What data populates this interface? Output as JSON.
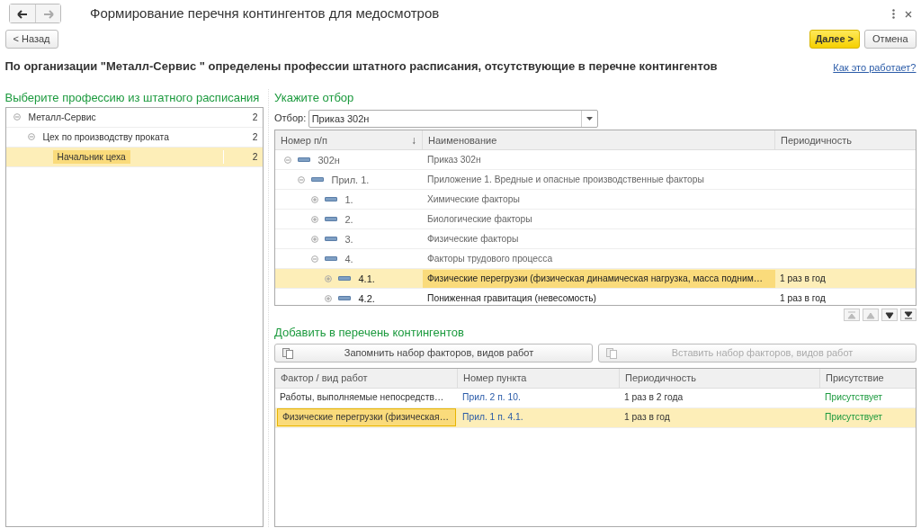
{
  "window": {
    "title": "Формирование перечня контингентов для медосмотров"
  },
  "toolbar": {
    "back": "< Назад",
    "next": "Далее >",
    "cancel": "Отмена"
  },
  "heading": "По организации \"Металл-Сервис \" определены профессии штатного расписания, отсутствующие в перечне контингентов",
  "help_link": "Как это работает?",
  "professions": {
    "title": "Выберите профессию из штатного расписания",
    "items": [
      {
        "label": "Металл-Сервис",
        "count": "2",
        "expanded": true,
        "selected": false,
        "children": [
          {
            "label": "Цех по производству проката",
            "count": "2",
            "expanded": true,
            "selected": false,
            "children": [
              {
                "label": "Начальник цеха",
                "count": "2",
                "selected": true
              }
            ]
          }
        ]
      }
    ]
  },
  "filter": {
    "title": "Укажите отбор",
    "label": "Отбор:",
    "value": "Приказ 302н"
  },
  "factors": {
    "columns": [
      "Номер п/п",
      "Наименование",
      "Периодичность"
    ],
    "sort_mark": "↓",
    "rows": [
      {
        "number": "302н",
        "name": "Приказ 302н",
        "group": true,
        "expanded": true,
        "selected": false,
        "children": [
          {
            "number": "Прил. 1.",
            "name": "Приложение 1. Вредные и опасные производственные факторы",
            "group": true,
            "expanded": true,
            "selected": false,
            "children": [
              {
                "number": "1.",
                "name": "Химические факторы",
                "group": true,
                "expanded": false,
                "selected": false
              },
              {
                "number": "2.",
                "name": "Биологические факторы",
                "group": true,
                "expanded": false,
                "selected": false
              },
              {
                "number": "3.",
                "name": "Физические факторы",
                "group": true,
                "expanded": false,
                "selected": false
              },
              {
                "number": "4.",
                "name": "Факторы трудового процесса",
                "group": true,
                "expanded": true,
                "selected": false,
                "children": [
                  {
                    "number": "4.1.",
                    "name": "Физические перегрузки (физическая динамическая нагрузка, масса подним…",
                    "period": "1 раз в год",
                    "group": false,
                    "expanded": false,
                    "selected": true
                  },
                  {
                    "number": "4.2.",
                    "name": "Пониженная гравитация (невесомость)",
                    "period": "1 раз в год",
                    "group": false,
                    "expanded": false,
                    "selected": false
                  }
                ]
              }
            ]
          }
        ]
      }
    ]
  },
  "contingents": {
    "title": "Добавить в перечень контингентов",
    "buttons": [
      {
        "label": "Запомнить набор факторов, видов работ",
        "disabled": false
      },
      {
        "label": "Вставить набор факторов, видов работ",
        "disabled": true
      }
    ],
    "columns": [
      "Фактор / вид работ",
      "Номер пункта",
      "Периодичность",
      "Присутствие"
    ],
    "rows": [
      {
        "factor": "Работы, выполняемые непосредств…",
        "item": "Прил. 2 п. 10.",
        "period": "1 раз в 2 года",
        "presence": "Присутствует",
        "selected": false
      },
      {
        "factor": "Физические перегрузки (физическая…",
        "item": "Прил. 1 п. 4.1.",
        "period": "1 раз в год",
        "presence": "Присутствует",
        "selected": true
      }
    ]
  }
}
